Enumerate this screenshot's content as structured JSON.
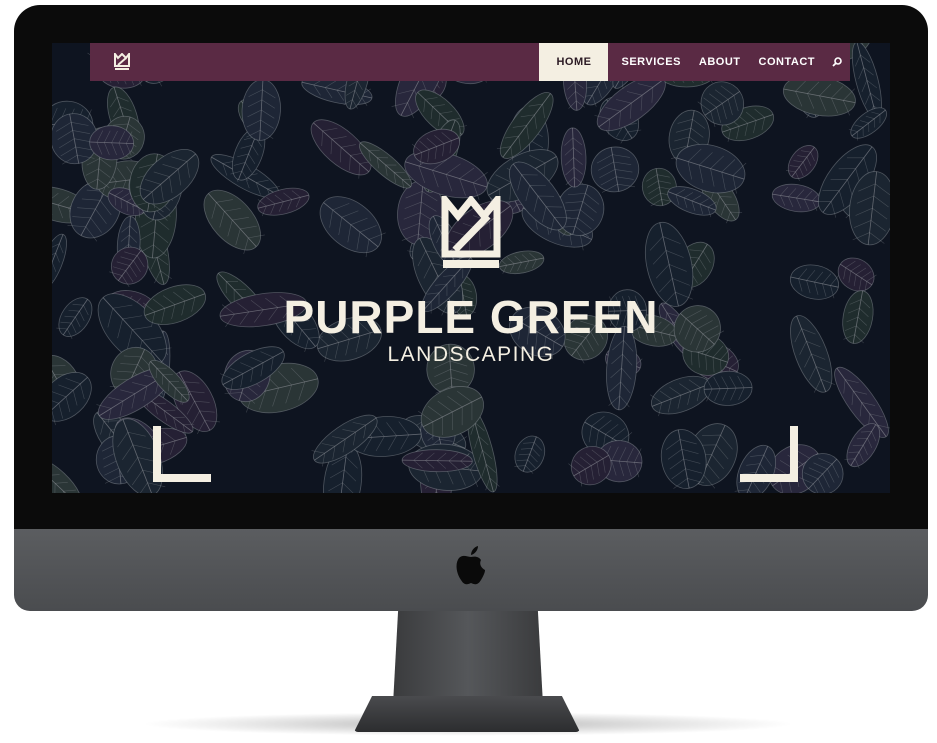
{
  "nav": {
    "items": [
      {
        "label": "HOME",
        "active": true
      },
      {
        "label": "SERVICES",
        "active": false
      },
      {
        "label": "ABOUT",
        "active": false
      },
      {
        "label": "CONTACT",
        "active": false
      }
    ],
    "search_icon": "search-icon",
    "logo_icon": "crown-logo-icon"
  },
  "hero": {
    "title": "PURPLE GREEN",
    "subtitle": "LANDSCAPING",
    "logo_icon": "crown-logo-icon",
    "corner_icons": [
      "corner-bracket-left-icon",
      "corner-bracket-right-icon"
    ]
  },
  "colors": {
    "navbar": "#5a2a44",
    "active_tab": "#f4efe2",
    "hero_text": "#f4efe2",
    "background": "#0f1420"
  },
  "device": {
    "apple_logo_icon": "apple-logo-icon"
  }
}
